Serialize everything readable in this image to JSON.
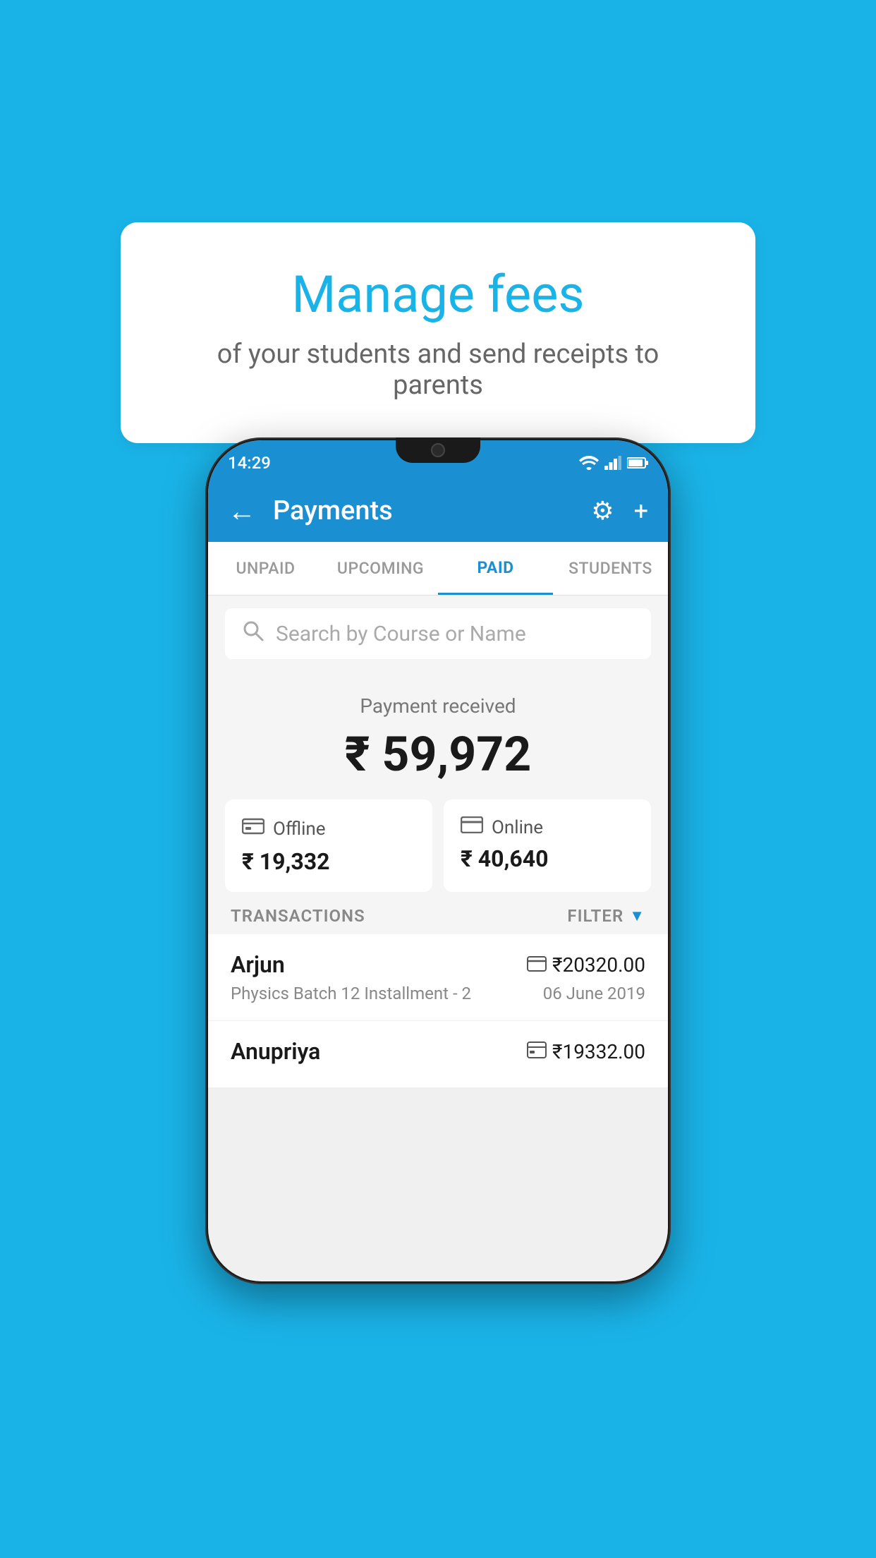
{
  "background_color": "#1ab3e8",
  "tooltip": {
    "title": "Manage fees",
    "subtitle": "of your students and send receipts to parents"
  },
  "status_bar": {
    "time": "14:29",
    "wifi_icon": "▼◀",
    "signal_icon": "◀",
    "battery_icon": "▮"
  },
  "header": {
    "title": "Payments",
    "back_label": "←",
    "gear_icon": "⚙",
    "plus_icon": "+"
  },
  "tabs": [
    {
      "label": "UNPAID",
      "active": false
    },
    {
      "label": "UPCOMING",
      "active": false
    },
    {
      "label": "PAID",
      "active": true
    },
    {
      "label": "STUDENTS",
      "active": false
    }
  ],
  "search": {
    "placeholder": "Search by Course or Name"
  },
  "payment_summary": {
    "label": "Payment received",
    "total": "₹ 59,972",
    "offline": {
      "icon": "💳",
      "label": "Offline",
      "amount": "₹ 19,332"
    },
    "online": {
      "icon": "💳",
      "label": "Online",
      "amount": "₹ 40,640"
    }
  },
  "transactions": {
    "header_label": "TRANSACTIONS",
    "filter_label": "FILTER",
    "items": [
      {
        "name": "Arjun",
        "course": "Physics Batch 12 Installment - 2",
        "amount": "₹20320.00",
        "date": "06 June 2019",
        "payment_type": "online"
      },
      {
        "name": "Anupriya",
        "course": "",
        "amount": "₹19332.00",
        "date": "",
        "payment_type": "offline"
      }
    ]
  }
}
